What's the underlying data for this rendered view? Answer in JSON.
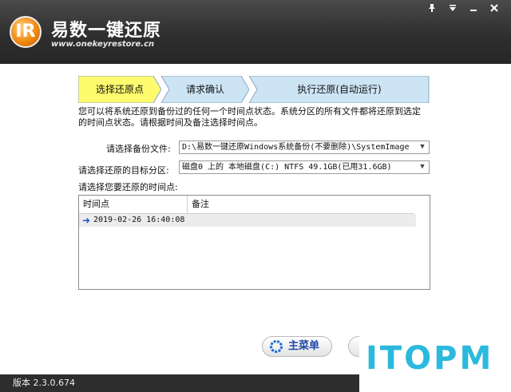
{
  "app": {
    "title": "易数一键还原",
    "subtitle": "www.onekeyrestore.cn",
    "version": "版本 2.3.0.674"
  },
  "window_buttons": [
    "pin-icon",
    "menu-icon",
    "minimize-icon",
    "close-icon"
  ],
  "steps": [
    {
      "label": "选择还原点",
      "active": true
    },
    {
      "label": "请求确认",
      "active": false
    },
    {
      "label": "执行还原(自动运行)",
      "active": false
    }
  ],
  "description": {
    "line1": "您可以将系统还原到备份过的任何一个时间点状态。系统分区的所有文件都将还原到选定",
    "line2": "的时间点状态。请根据时间及备注选择时间点。"
  },
  "form": {
    "backup_file_label": "请选择备份文件:",
    "backup_file_value": "D:\\易数一键还原Windows系统备份(不要删除)\\SystemImage",
    "target_partition_label": "请选择还原的目标分区:",
    "target_partition_value": "磁盘0 上的 本地磁盘(C:) NTFS 49.1GB(已用31.6GB)",
    "restore_point_label": "请选择您要还原的时间点:"
  },
  "table": {
    "columns": [
      "时间点",
      "备注"
    ],
    "rows": [
      {
        "time": "2019-02-26 16:40:08",
        "note": ""
      }
    ]
  },
  "buttons": {
    "main_menu": "主菜单"
  },
  "watermark": "ITOPM",
  "colors": {
    "active_step": "#fffb6e",
    "inactive_step": "#cde4f5",
    "titlebar": "#333333",
    "accent_blue": "#1d47a8",
    "watermark": "#2bb9de"
  }
}
